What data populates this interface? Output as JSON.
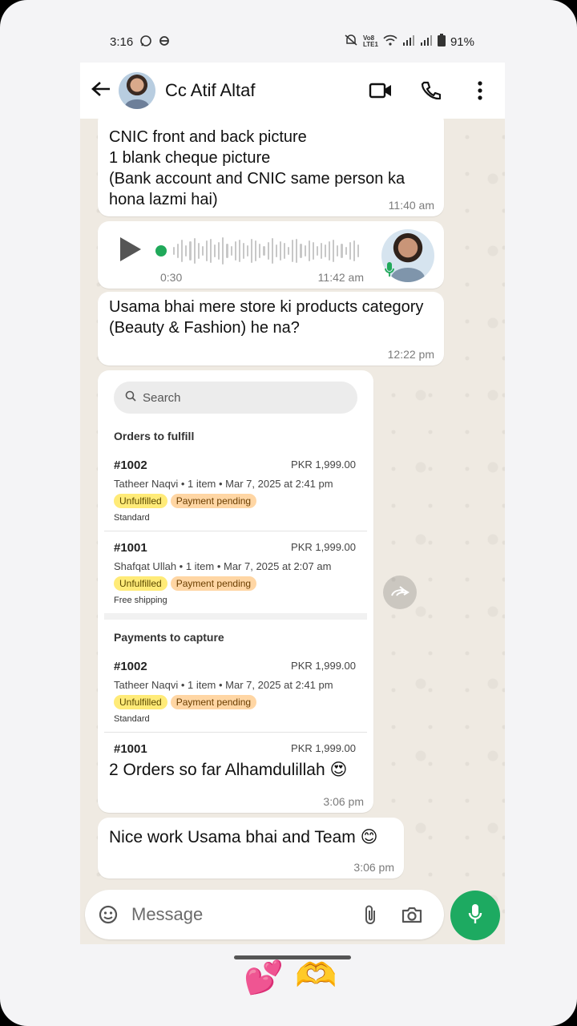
{
  "status_bar": {
    "time": "3:16",
    "battery": "91%",
    "icons": [
      "whatsapp-icon",
      "notification-icon",
      "mute-icon",
      "volte-icon",
      "wifi-icon",
      "signal-icon",
      "signal-icon",
      "battery-icon"
    ],
    "volte_label": "Vo8\nLTE1"
  },
  "header": {
    "contact_name": "Cc Atif Altaf",
    "icons": [
      "back-arrow-icon",
      "video-call-icon",
      "voice-call-icon",
      "more-vert-icon"
    ]
  },
  "messages": [
    {
      "type": "text",
      "text": "CNIC front and back picture\n1 blank cheque picture\n(Bank account and CNIC same person ka hona lazmi hai)",
      "time": "11:40 am"
    },
    {
      "type": "voice",
      "duration": "0:30",
      "time": "11:42 am"
    },
    {
      "type": "text",
      "text": "Usama bhai mere store ki products category (Beauty & Fashion) he na?",
      "time": "12:22 pm"
    },
    {
      "type": "image",
      "caption": "2 Orders so far Alhamdulillah 😍",
      "time": "3:06 pm",
      "screenshot": {
        "search_placeholder": "Search",
        "sections": [
          {
            "title": "Orders to fulfill",
            "orders": [
              {
                "number": "#1002",
                "amount": "PKR 1,999.00",
                "meta": "Tatheer Naqvi • 1 item • Mar 7, 2025 at 2:41 pm",
                "badges": [
                  "Unfulfilled",
                  "Payment pending"
                ],
                "shipping": "Standard"
              },
              {
                "number": "#1001",
                "amount": "PKR 1,999.00",
                "meta": "Shafqat Ullah • 1 item • Mar 7, 2025 at 2:07 am",
                "badges": [
                  "Unfulfilled",
                  "Payment pending"
                ],
                "shipping": "Free shipping"
              }
            ]
          },
          {
            "title": "Payments to capture",
            "orders": [
              {
                "number": "#1002",
                "amount": "PKR 1,999.00",
                "meta": "Tatheer Naqvi • 1 item • Mar 7, 2025 at 2:41 pm",
                "badges": [
                  "Unfulfilled",
                  "Payment pending"
                ],
                "shipping": "Standard"
              },
              {
                "number": "#1001",
                "amount": "PKR 1,999.00"
              }
            ]
          }
        ]
      }
    },
    {
      "type": "text",
      "text": "Nice work Usama bhai and Team 😊",
      "time": "3:06 pm"
    }
  ],
  "composer": {
    "placeholder": "Message",
    "icons": [
      "sticker-icon",
      "attach-icon",
      "camera-icon",
      "mic-icon"
    ]
  },
  "overlay_stickers": [
    "💕",
    "🫶"
  ],
  "colors": {
    "accent": "#1daa61",
    "chat_bg": "#efeae2",
    "unfulfilled": "#ffeb78",
    "payment_pending": "#ffd6a4"
  }
}
